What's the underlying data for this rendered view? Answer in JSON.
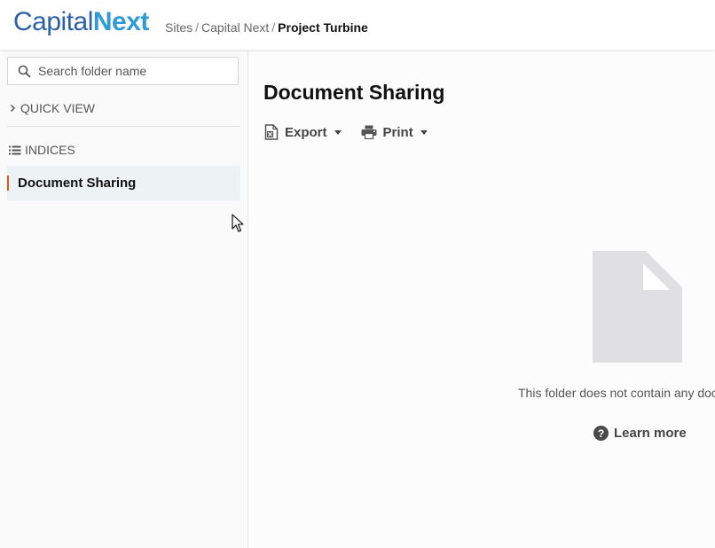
{
  "header": {
    "logo": {
      "part1": "Capital",
      "part2": "Next"
    },
    "breadcrumb": {
      "items": [
        "Sites",
        "Capital Next"
      ],
      "separator": "/",
      "current": "Project Turbine"
    }
  },
  "sidebar": {
    "search": {
      "placeholder": "Search folder name",
      "value": "",
      "icon": "search-icon"
    },
    "sections": [
      {
        "label": "QUICK VIEW",
        "icon": "chevron-right-icon"
      },
      {
        "label": "INDICES",
        "icon": "list-icon"
      }
    ],
    "items": [
      {
        "label": "Document Sharing",
        "selected": true
      }
    ]
  },
  "main": {
    "title": "Document Sharing",
    "toolbar": {
      "export_label": "Export",
      "print_label": "Print"
    },
    "empty_state": {
      "message": "This folder does not contain any doc",
      "learn_more": "Learn more",
      "help_glyph": "?"
    }
  },
  "colors": {
    "logo_capital": "#2b5fa8",
    "logo_next": "#2f9ad8",
    "selected_accent": "#e35a16",
    "selected_bg": "#edf3f5",
    "empty_icon": "#e0e0e3"
  }
}
